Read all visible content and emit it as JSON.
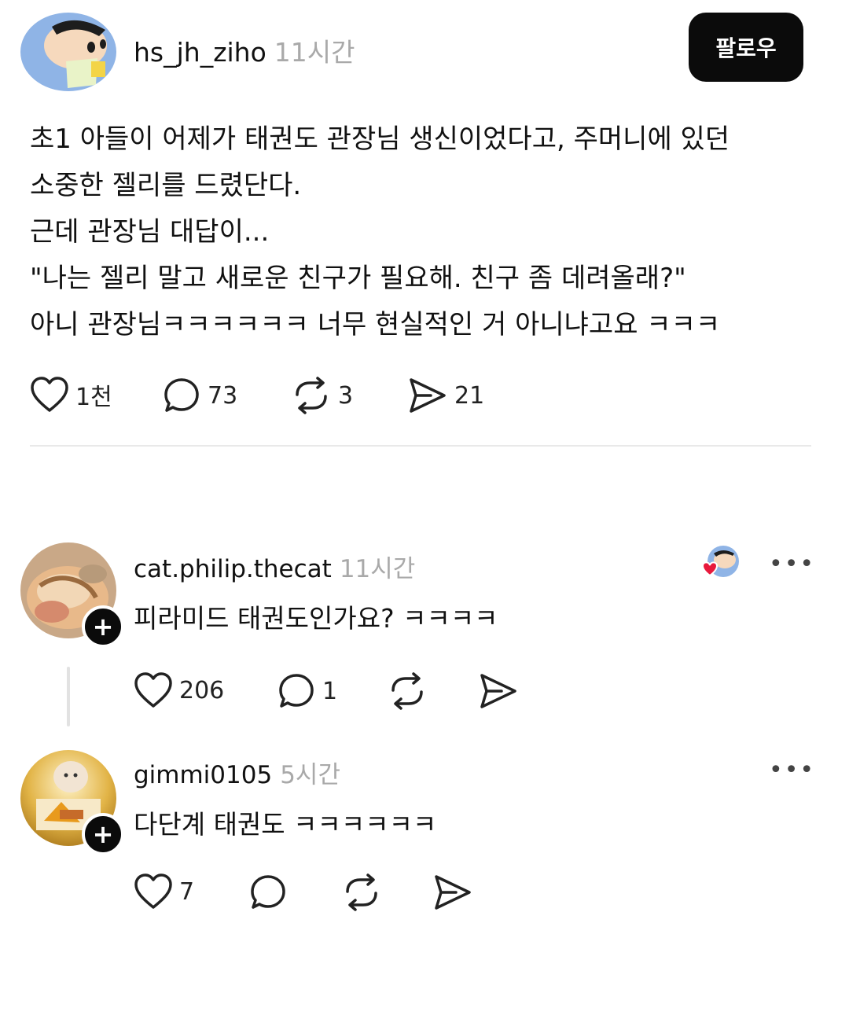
{
  "post": {
    "username": "hs_jh_ziho",
    "time": "11시간",
    "follow_label": "팔로우",
    "lines": [
      "초1 아들이 어제가 태권도 관장님 생신이었다고, 주머니에 있던",
      "소중한 젤리를 드렸단다.",
      "근데 관장님 대답이...",
      "\"나는 젤리 말고 새로운 친구가 필요해. 친구 좀 데려올래?\"",
      "아니 관장님ㅋㅋㅋㅋㅋㅋ 너무 현실적인 거 아니냐고요 ㅋㅋㅋ"
    ],
    "likes": "1천",
    "comments": "73",
    "reposts": "3",
    "shares": "21"
  },
  "comments": [
    {
      "username": "cat.philip.thecat",
      "time": "11시간",
      "text": "피라미드 태권도인가요? ㅋㅋㅋㅋ",
      "likes": "206",
      "replies": "1",
      "more": "•••"
    },
    {
      "username": "gimmi0105",
      "time": "5시간",
      "text": "다단계 태권도 ㅋㅋㅋㅋㅋㅋ",
      "likes": "7",
      "more": "•••"
    }
  ],
  "icons": {
    "like": "heart-icon",
    "comment": "comment-bubble-icon",
    "repost": "repost-icon",
    "share": "send-icon",
    "more": "more-dots-icon",
    "follow_badge": "plus-icon"
  },
  "colors": {
    "accent_black": "#0b0b0b",
    "muted_text": "#a9a9a9",
    "divider": "#e9e9e9",
    "heart_red": "#e8193c"
  }
}
